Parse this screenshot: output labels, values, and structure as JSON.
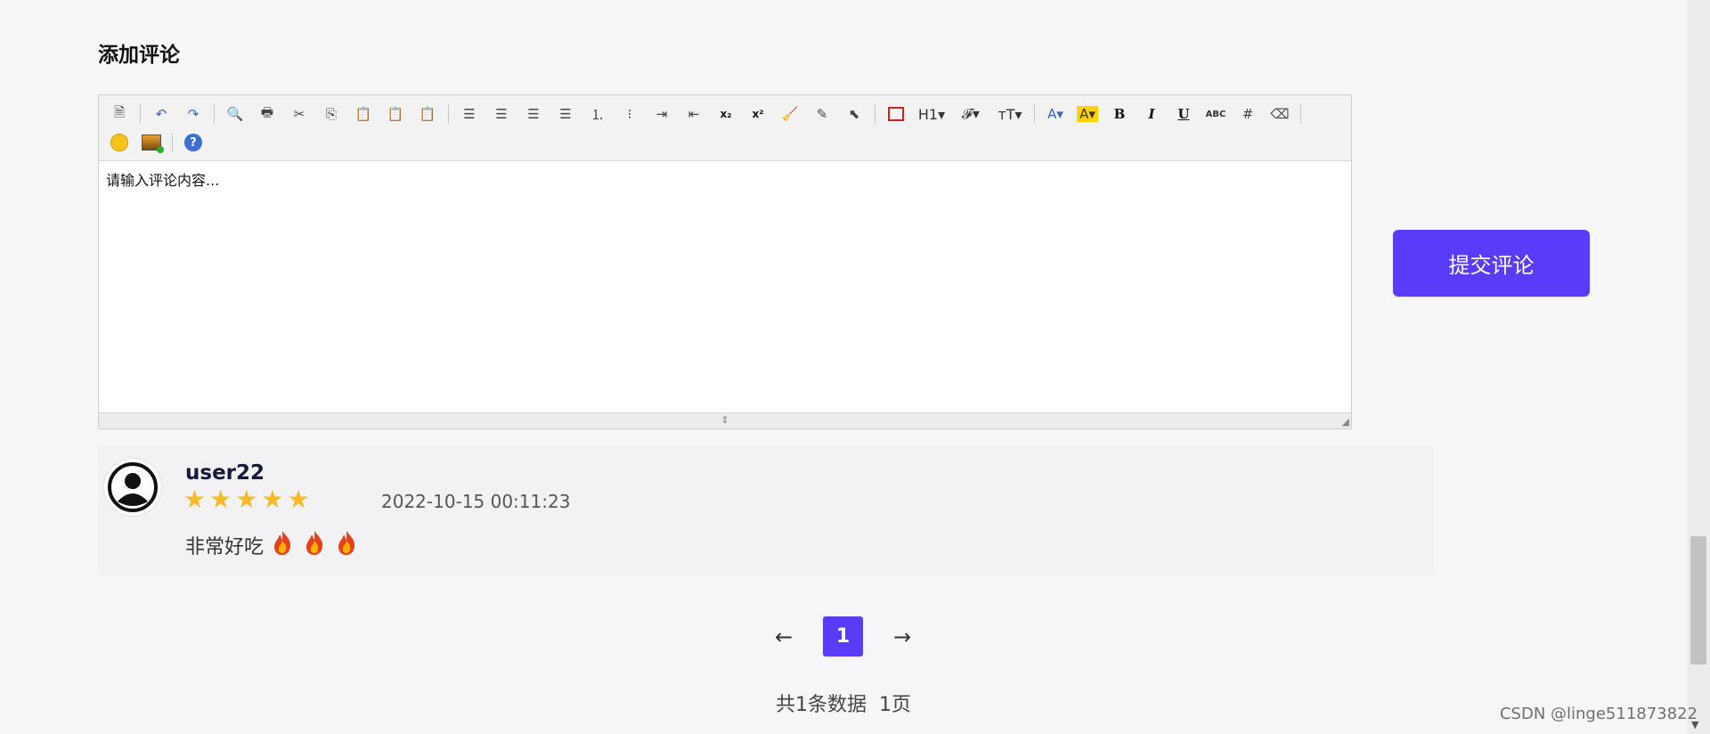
{
  "section_title": "添加评论",
  "editor": {
    "placeholder": "请输入评论内容...",
    "toolbar_row1": [
      {
        "icon": "source-icon",
        "glyph": "🗎"
      },
      {
        "sep": true
      },
      {
        "icon": "undo-icon",
        "glyph": "↶",
        "color": "blue"
      },
      {
        "icon": "redo-icon",
        "glyph": "↷",
        "color": "blue"
      },
      {
        "sep": true
      },
      {
        "icon": "preview-icon",
        "glyph": "🔍"
      },
      {
        "icon": "print-icon",
        "glyph": "🖶"
      },
      {
        "icon": "cut-icon",
        "glyph": "✂"
      },
      {
        "icon": "copy-icon",
        "glyph": "⎘"
      },
      {
        "icon": "paste-icon",
        "glyph": "📋"
      },
      {
        "icon": "paste-text-icon",
        "glyph": "📋"
      },
      {
        "icon": "paste-word-icon",
        "glyph": "📋"
      },
      {
        "sep": true
      },
      {
        "icon": "align-left-icon",
        "glyph": "☰"
      },
      {
        "icon": "align-center-icon",
        "glyph": "☰"
      },
      {
        "icon": "align-right-icon",
        "glyph": "☰"
      },
      {
        "icon": "align-justify-icon",
        "glyph": "☰"
      },
      {
        "icon": "ordered-list-icon",
        "glyph": "⒈"
      },
      {
        "icon": "unordered-list-icon",
        "glyph": "⁝"
      },
      {
        "icon": "indent-icon",
        "glyph": "⇥"
      },
      {
        "icon": "outdent-icon",
        "glyph": "⇤"
      },
      {
        "icon": "subscript-icon",
        "glyph": "x₂"
      },
      {
        "icon": "superscript-icon",
        "glyph": "x²"
      },
      {
        "icon": "clear-format-icon",
        "glyph": "🧹"
      },
      {
        "icon": "quick-format-icon",
        "glyph": "✎"
      },
      {
        "icon": "select-all-icon",
        "glyph": "⬉"
      },
      {
        "sep": true
      },
      {
        "icon": "fullscreen-icon",
        "glyph": ""
      },
      {
        "icon": "heading-icon",
        "glyph": "H1▾"
      },
      {
        "icon": "font-family-icon",
        "glyph": "𝓕▾"
      },
      {
        "icon": "font-size-icon",
        "glyph": "тT▾"
      },
      {
        "sep": true
      },
      {
        "icon": "font-color-icon",
        "glyph": "A▾",
        "color": "blue"
      },
      {
        "icon": "highlight-color-icon",
        "glyph": "A▾"
      },
      {
        "icon": "bold-icon",
        "glyph": "B"
      },
      {
        "icon": "italic-icon",
        "glyph": "I"
      },
      {
        "icon": "underline-icon",
        "glyph": "U"
      },
      {
        "icon": "strikethrough-icon",
        "glyph": "ABC"
      },
      {
        "icon": "table-icon",
        "glyph": "#"
      },
      {
        "icon": "eraser-icon",
        "glyph": "⌫"
      },
      {
        "sep": true
      }
    ],
    "toolbar_row2": [
      {
        "icon": "emoticons-icon"
      },
      {
        "icon": "insert-image-icon"
      },
      {
        "sep": true
      },
      {
        "icon": "help-icon",
        "glyph": "?"
      }
    ]
  },
  "submit_label": "提交评论",
  "comment": {
    "username": "user22",
    "rating": 5,
    "rating_max": 5,
    "timestamp": "2022-10-15 00:11:23",
    "text": "非常好吃",
    "emoji_count": 3,
    "emoji_icon": "fire-emoji-icon"
  },
  "pagination": {
    "prev": "←",
    "current": "1",
    "next": "→",
    "summary": "共1条数据  1页"
  },
  "watermark": "CSDN @linge511873822",
  "colors": {
    "accent": "#5b3bfa",
    "star": "#f5b92a"
  }
}
